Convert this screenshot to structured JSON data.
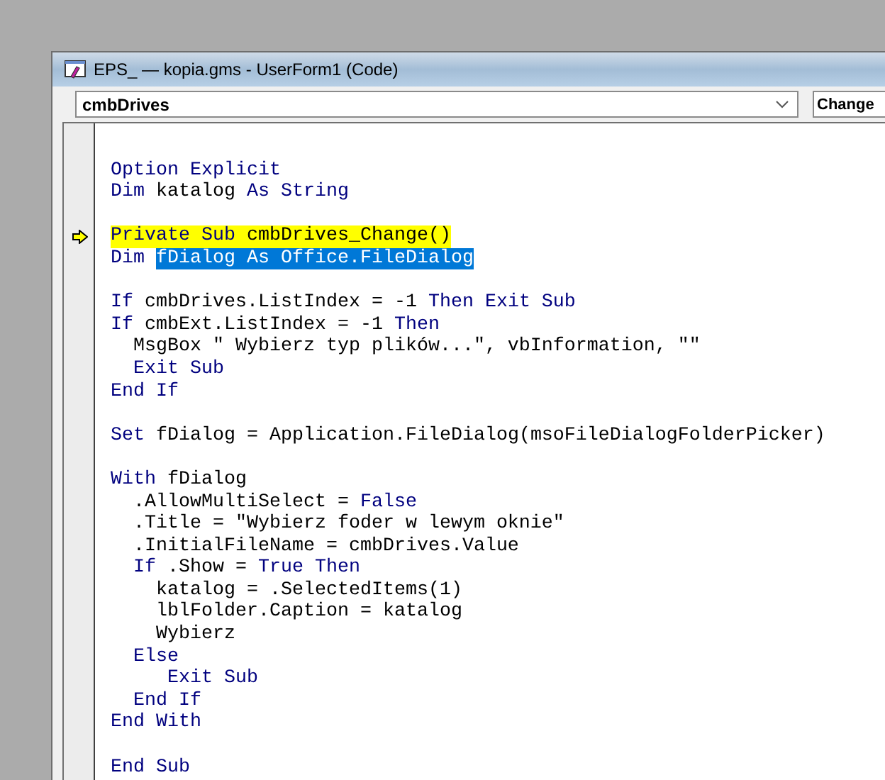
{
  "window": {
    "title": "EPS_ — kopia.gms - UserForm1 (Code)"
  },
  "toolbar": {
    "object_combo": {
      "value": "cmbDrives"
    },
    "procedure_combo": {
      "value": "Change"
    }
  },
  "code_lines": [
    {
      "kind": "blank"
    },
    {
      "kind": "code",
      "current": false,
      "tokens": [
        {
          "text": "Option Explicit",
          "kind": "kw"
        }
      ]
    },
    {
      "kind": "code",
      "current": false,
      "tokens": [
        {
          "text": "Dim",
          "kind": "kw"
        },
        {
          "text": " katalog ",
          "kind": "txt"
        },
        {
          "text": "As String",
          "kind": "kw"
        }
      ]
    },
    {
      "kind": "blank"
    },
    {
      "kind": "code",
      "current": true,
      "tokens": [
        {
          "text": "Private Sub",
          "kind": "kw"
        },
        {
          "text": " cmbDrives_Change()",
          "kind": "txt"
        }
      ]
    },
    {
      "kind": "code",
      "current": false,
      "tokens": [
        {
          "text": "Dim ",
          "kind": "kw"
        },
        {
          "text": "fDialog As Office.FileDialog",
          "kind": "sel"
        }
      ]
    },
    {
      "kind": "blank"
    },
    {
      "kind": "code",
      "current": false,
      "tokens": [
        {
          "text": "If",
          "kind": "kw"
        },
        {
          "text": " cmbDrives.ListIndex = -1 ",
          "kind": "txt"
        },
        {
          "text": "Then Exit Sub",
          "kind": "kw"
        }
      ]
    },
    {
      "kind": "code",
      "current": false,
      "tokens": [
        {
          "text": "If",
          "kind": "kw"
        },
        {
          "text": " cmbExt.ListIndex = -1 ",
          "kind": "txt"
        },
        {
          "text": "Then",
          "kind": "kw"
        }
      ]
    },
    {
      "kind": "code",
      "current": false,
      "tokens": [
        {
          "text": "  MsgBox \" Wybierz typ plików...\", vbInformation, \"\"",
          "kind": "txt"
        }
      ]
    },
    {
      "kind": "code",
      "current": false,
      "tokens": [
        {
          "text": "  Exit Sub",
          "kind": "kw"
        }
      ]
    },
    {
      "kind": "code",
      "current": false,
      "tokens": [
        {
          "text": "End If",
          "kind": "kw"
        }
      ]
    },
    {
      "kind": "blank"
    },
    {
      "kind": "code",
      "current": false,
      "tokens": [
        {
          "text": "Set",
          "kind": "kw"
        },
        {
          "text": " fDialog = Application.FileDialog(msoFileDialogFolderPicker)",
          "kind": "txt"
        }
      ]
    },
    {
      "kind": "blank"
    },
    {
      "kind": "code",
      "current": false,
      "tokens": [
        {
          "text": "With",
          "kind": "kw"
        },
        {
          "text": " fDialog",
          "kind": "txt"
        }
      ]
    },
    {
      "kind": "code",
      "current": false,
      "tokens": [
        {
          "text": "  .AllowMultiSelect = ",
          "kind": "txt"
        },
        {
          "text": "False",
          "kind": "kw"
        }
      ]
    },
    {
      "kind": "code",
      "current": false,
      "tokens": [
        {
          "text": "  .Title = \"Wybierz foder w lewym oknie\"",
          "kind": "txt"
        }
      ]
    },
    {
      "kind": "code",
      "current": false,
      "tokens": [
        {
          "text": "  .InitialFileName = cmbDrives.Value",
          "kind": "txt"
        }
      ]
    },
    {
      "kind": "code",
      "current": false,
      "tokens": [
        {
          "text": "  If",
          "kind": "kw"
        },
        {
          "text": " .Show = ",
          "kind": "txt"
        },
        {
          "text": "True Then",
          "kind": "kw"
        }
      ]
    },
    {
      "kind": "code",
      "current": false,
      "tokens": [
        {
          "text": "    katalog = .SelectedItems(1)",
          "kind": "txt"
        }
      ]
    },
    {
      "kind": "code",
      "current": false,
      "tokens": [
        {
          "text": "    lblFolder.Caption = katalog",
          "kind": "txt"
        }
      ]
    },
    {
      "kind": "code",
      "current": false,
      "tokens": [
        {
          "text": "    Wybierz",
          "kind": "txt"
        }
      ]
    },
    {
      "kind": "code",
      "current": false,
      "tokens": [
        {
          "text": "  Else",
          "kind": "kw"
        }
      ]
    },
    {
      "kind": "code",
      "current": false,
      "tokens": [
        {
          "text": "     Exit Sub",
          "kind": "kw"
        }
      ]
    },
    {
      "kind": "code",
      "current": false,
      "tokens": [
        {
          "text": "  End If",
          "kind": "kw"
        }
      ]
    },
    {
      "kind": "code",
      "current": false,
      "tokens": [
        {
          "text": "End With",
          "kind": "kw"
        }
      ]
    },
    {
      "kind": "blank"
    },
    {
      "kind": "code",
      "current": false,
      "tokens": [
        {
          "text": "End Sub",
          "kind": "kw"
        }
      ]
    }
  ]
}
